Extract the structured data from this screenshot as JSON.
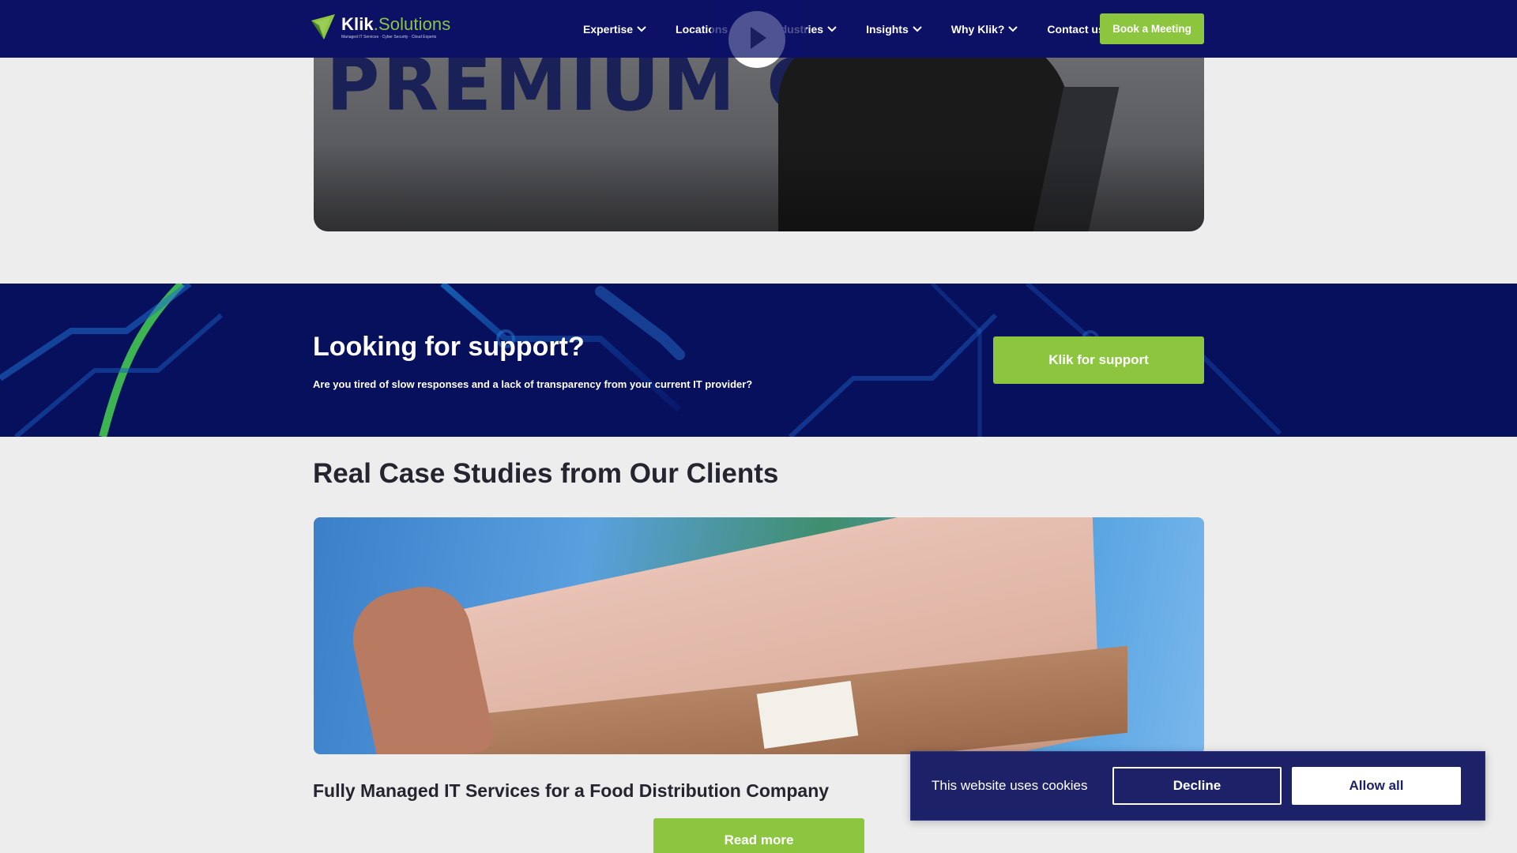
{
  "header": {
    "logo": {
      "name_part1": "Klik",
      "name_part2": ".Solutions",
      "tagline": "Managed IT Services · Cyber Security · Cloud Experts"
    },
    "nav": [
      {
        "label": "Expertise"
      },
      {
        "label": "Locations"
      },
      {
        "label": "Industries"
      },
      {
        "label": "Insights"
      },
      {
        "label": "Why Klik?"
      }
    ],
    "contact_label": "Contact us",
    "book_label": "Book a Meeting"
  },
  "video": {
    "bg_text": "PREMIUM CA      SA"
  },
  "support": {
    "title": "Looking for support?",
    "subtitle": "Are you tired of slow responses and a lack of transparency from your current IT provider?",
    "button_label": "Klik for support"
  },
  "case_studies": {
    "heading": "Real Case Studies from Our Clients",
    "item_title": "Fully Managed IT Services for a Food Distribution Company",
    "read_more_label": "Read more"
  },
  "cookie": {
    "text": "This website uses cookies",
    "decline_label": "Decline",
    "allow_label": "Allow all"
  },
  "colors": {
    "header_bg": "#0c1166",
    "accent_green": "#8cc63f",
    "banner_bg": "#07105c",
    "cookie_bg": "#1d2268",
    "page_bg": "#ededed"
  },
  "icons": [
    "klik-logo-icon",
    "chevron-down-icon",
    "play-icon"
  ]
}
